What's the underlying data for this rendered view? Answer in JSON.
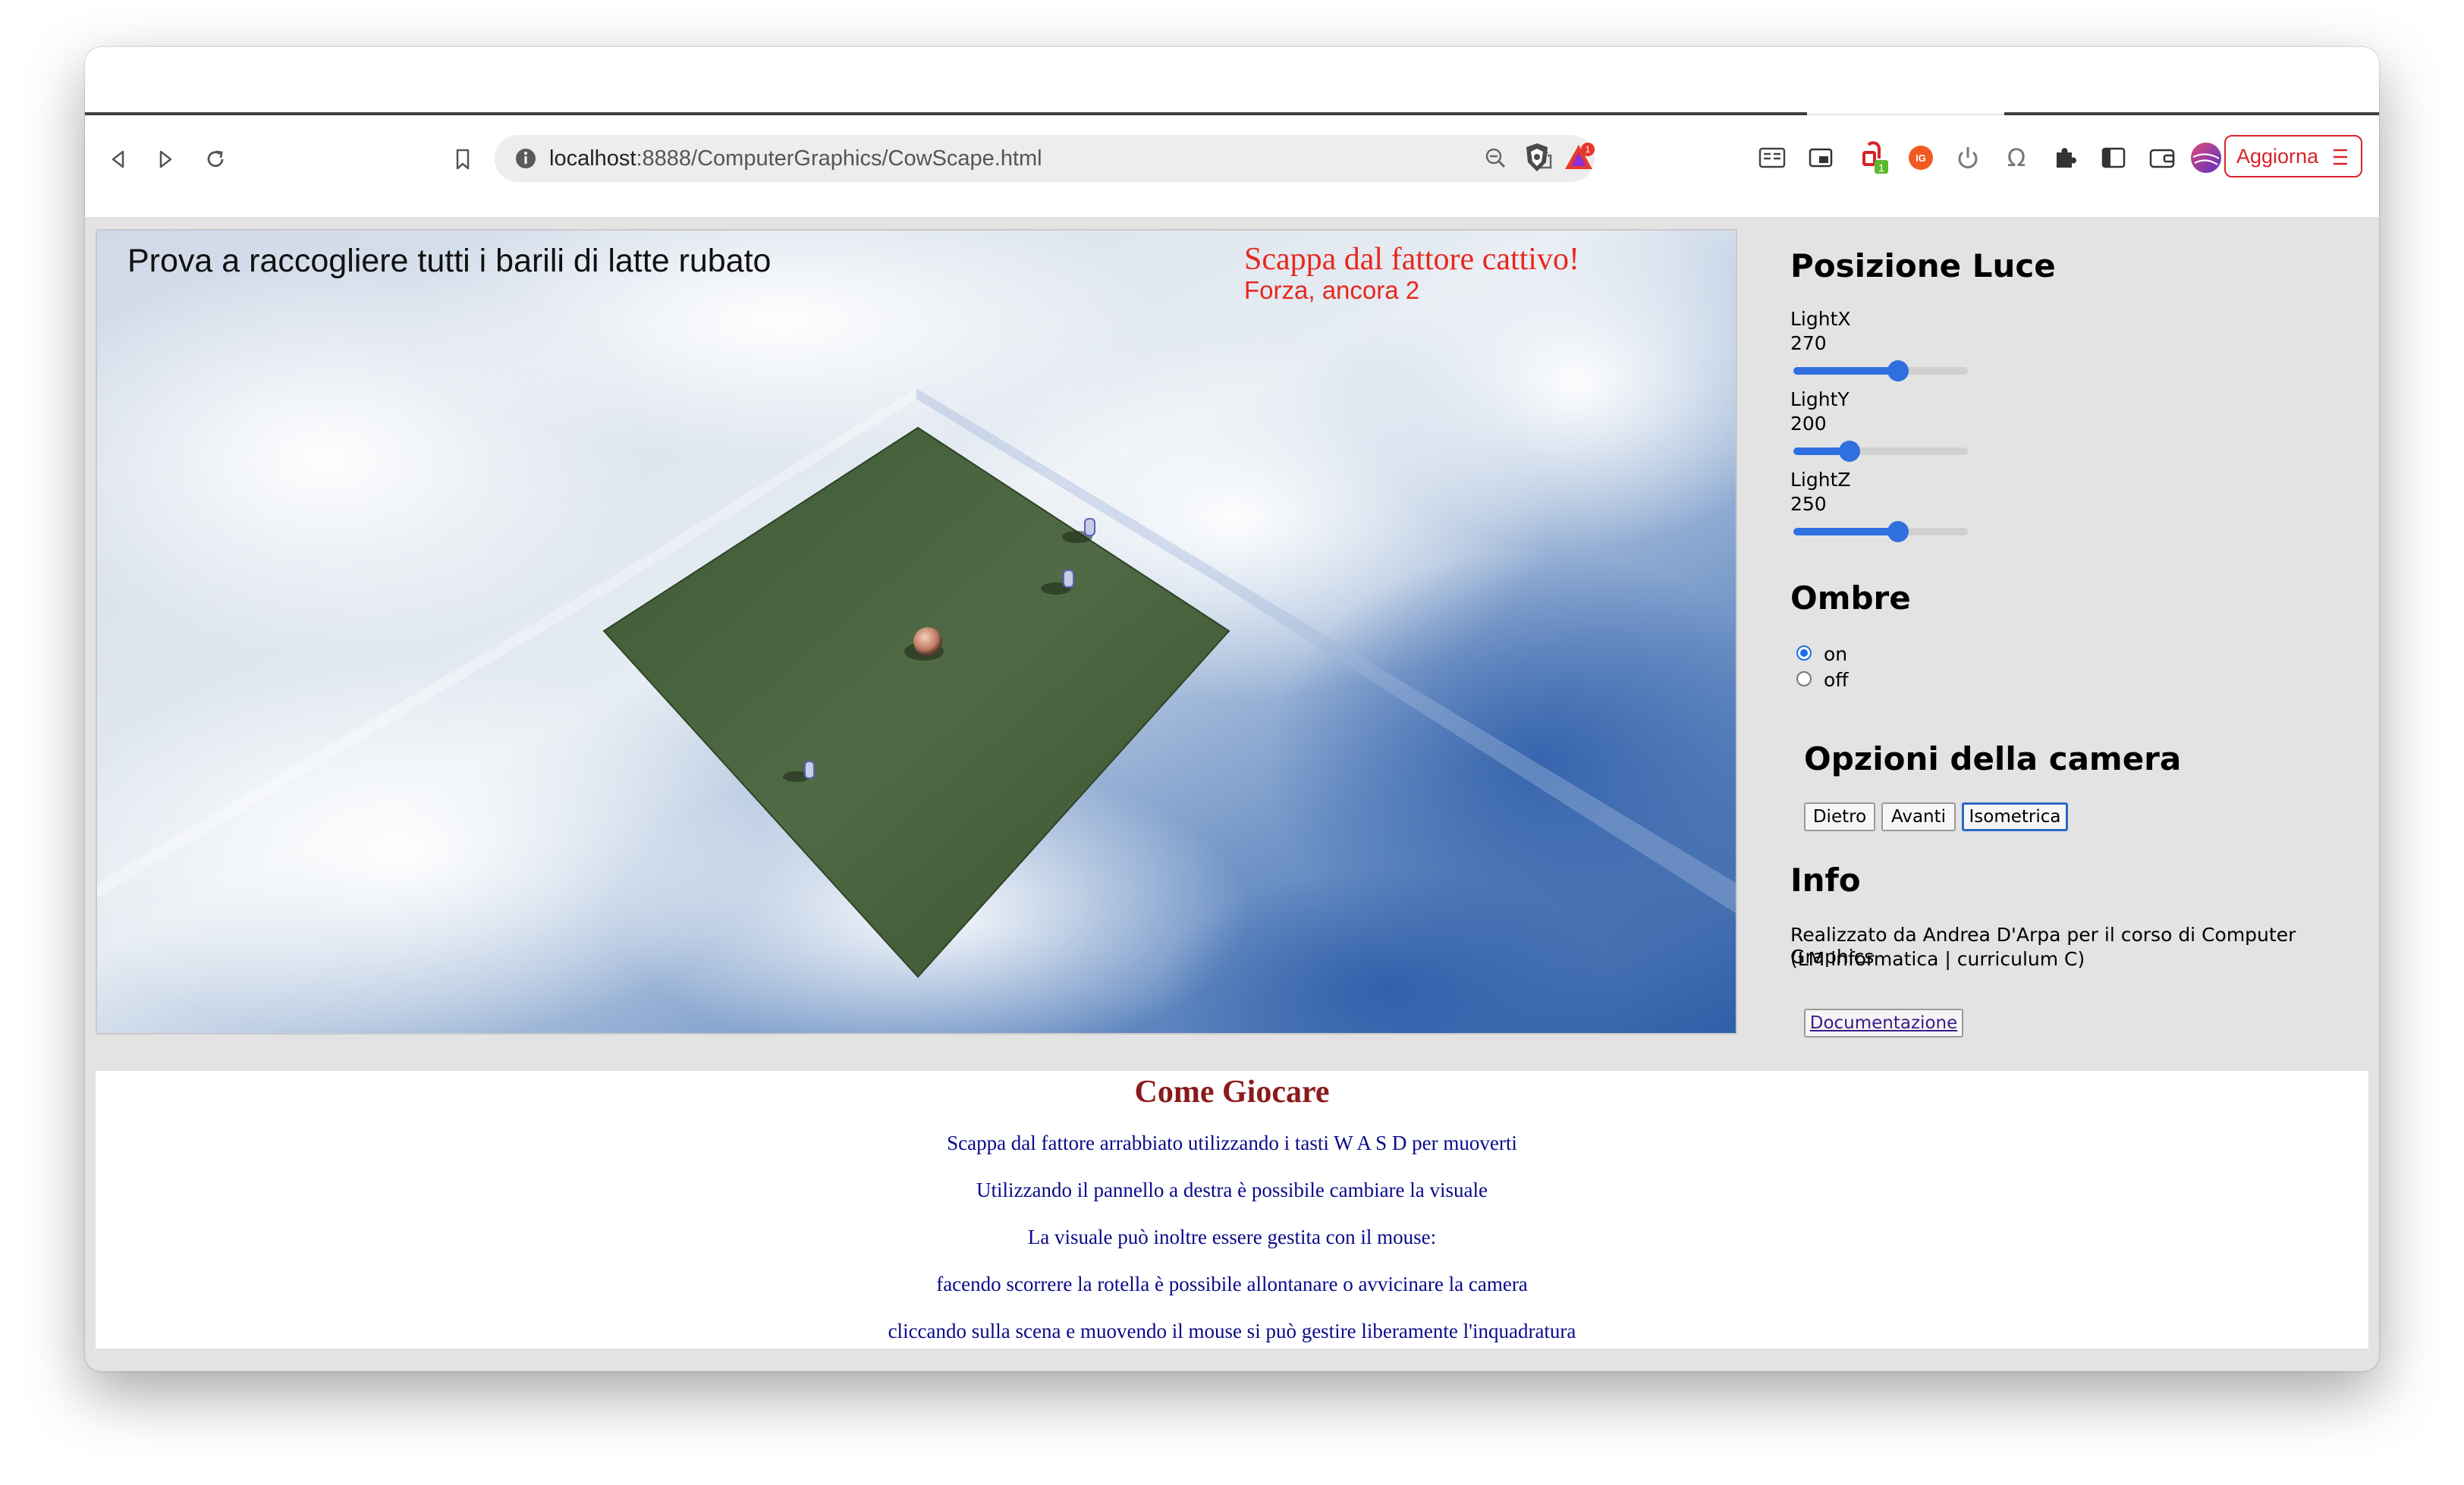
{
  "browser": {
    "url_host": "localhost",
    "url_path": ":8888/ComputerGraphics/CowScape.html",
    "update_label": "Aggiorna",
    "extension_badge": "1",
    "alert_badge": "1",
    "accent_color": "#d8232a"
  },
  "hud": {
    "objective": "Prova a raccogliere tutti i barili di latte rubato",
    "warning": "Scappa dal fattore cattivo!",
    "counter": "Forza, ancora 2"
  },
  "panel": {
    "light_title": "Posizione Luce",
    "lights": [
      {
        "label": "LightX",
        "value": "270",
        "fraction": 0.6
      },
      {
        "label": "LightY",
        "value": "200",
        "fraction": 0.32
      },
      {
        "label": "LightZ",
        "value": "250",
        "fraction": 0.6
      }
    ],
    "shadows_title": "Ombre",
    "shadow_options": [
      {
        "label": "on",
        "selected": true
      },
      {
        "label": "off",
        "selected": false
      }
    ],
    "camera_title": "Opzioni della camera",
    "camera_buttons": [
      {
        "label": "Dietro",
        "active": false
      },
      {
        "label": "Avanti",
        "active": false
      },
      {
        "label": "Isometrica",
        "active": true
      }
    ],
    "info_title": "Info",
    "info_line1": "Realizzato da Andrea D'Arpa per il corso di Computer Graphics",
    "info_line2": "(LM informatica | curriculum C)",
    "doc_button": "Documentazione"
  },
  "howto": {
    "title": "Come Giocare",
    "lines": [
      "Scappa dal fattore arrabbiato utilizzando i tasti W A S D per muoverti",
      "Utilizzando il pannello a destra è possibile cambiare la visuale",
      "La visuale può inoltre essere gestita con il mouse:",
      "facendo scorrere la rotella è possibile allontanare o avvicinare la camera",
      "cliccando sulla scena e muovendo il mouse si può gestire liberamente l'inquadratura"
    ]
  }
}
